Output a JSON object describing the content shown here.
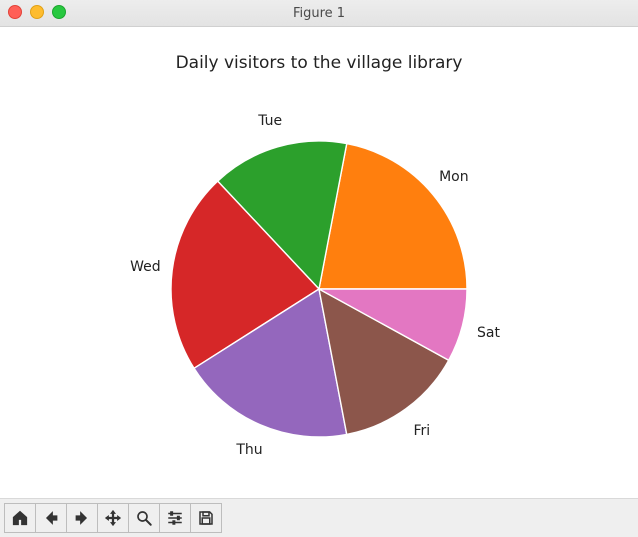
{
  "window": {
    "title": "Figure 1"
  },
  "toolbar": {
    "home": "Home",
    "back": "Back",
    "forward": "Forward",
    "pan": "Pan",
    "zoom": "Zoom",
    "config": "Configure subplots",
    "save": "Save"
  },
  "chart_data": {
    "type": "pie",
    "title": "Daily visitors to the village library",
    "categories": [
      "Mon",
      "Tue",
      "Wed",
      "Thu",
      "Fri",
      "Sat"
    ],
    "values": [
      22,
      15,
      22,
      19,
      14,
      8
    ],
    "colors": [
      "#ff7f0e",
      "#2ca02c",
      "#d62728",
      "#9467bd",
      "#8c564b",
      "#e377c2"
    ],
    "start_angle_deg": 0,
    "direction": "counterclockwise"
  }
}
